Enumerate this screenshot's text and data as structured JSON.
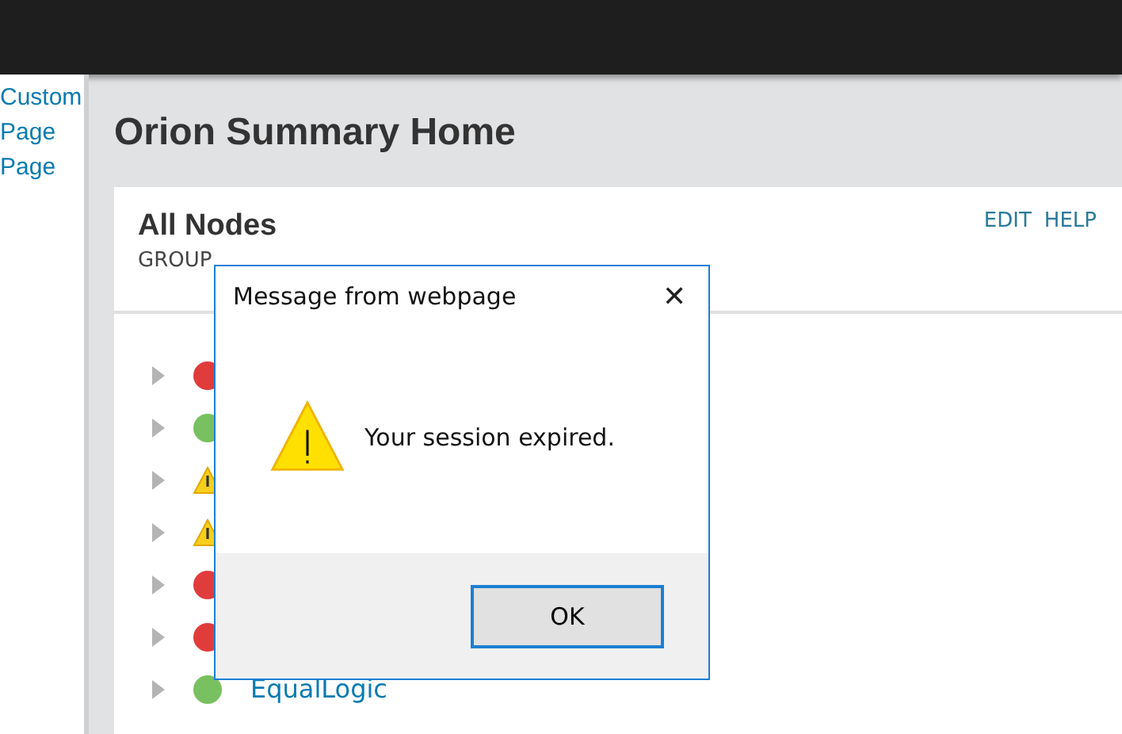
{
  "sidebar": {
    "links": [
      "Custom",
      "Page",
      "Page"
    ]
  },
  "page": {
    "title": "Orion Summary Home"
  },
  "card": {
    "title": "All Nodes",
    "subtitle": "GROUP",
    "actions": [
      "EDIT",
      "HELP"
    ],
    "nodes": [
      {
        "kind": "down"
      },
      {
        "kind": "up"
      },
      {
        "kind": "warning"
      },
      {
        "kind": "warning"
      },
      {
        "kind": "down"
      },
      {
        "kind": "down"
      },
      {
        "kind": "up",
        "name": "EqualLogic"
      }
    ]
  },
  "dialog": {
    "title": "Message from webpage",
    "close": "✕",
    "message": "Your session expired.",
    "buttons": [
      "OK"
    ]
  }
}
